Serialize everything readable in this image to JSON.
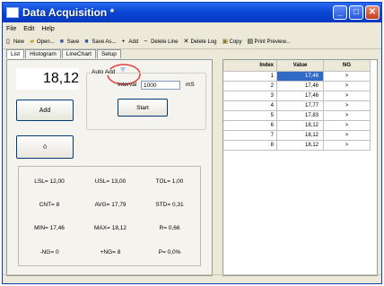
{
  "window": {
    "title": "Data Acquisition *"
  },
  "menu": [
    "File",
    "Edit",
    "Help"
  ],
  "toolbar": {
    "new": "New",
    "open": "Open...",
    "save": "Save",
    "save_as": "Save As...",
    "add": "Add",
    "delete_line": "Delete Line",
    "delete_log": "Delete Log",
    "copy": "Copy",
    "print_preview": "Print Preview..."
  },
  "tabs": [
    "List",
    "Histogram",
    "LineChart",
    "Setup"
  ],
  "current_value": "18,12",
  "auto_add": {
    "legend": "Auto Add",
    "interval_label": "Interval",
    "interval_value": "1000",
    "unit": "mS",
    "start_label": "Start"
  },
  "add_button": "Add",
  "counter_value": "0",
  "stats": [
    [
      "LSL= 12,00",
      "USL= 13,00",
      "TOL= 1,00"
    ],
    [
      "CNT= 8",
      "AVG= 17,79",
      "STD= 0,31"
    ],
    [
      "MIN= 17,46",
      "MAX= 18,12",
      "R= 0,66"
    ],
    [
      "-NG= 0",
      "+NG= 8",
      "P= 0,0%"
    ]
  ],
  "grid": {
    "headers": [
      "Index",
      "Value",
      "NG"
    ],
    "rows": [
      [
        "1",
        "17,46",
        ">"
      ],
      [
        "2",
        "17,46",
        ">"
      ],
      [
        "3",
        "17,46",
        ">"
      ],
      [
        "4",
        "17,77",
        ">"
      ],
      [
        "5",
        "17,83",
        ">"
      ],
      [
        "6",
        "18,12",
        ">"
      ],
      [
        "7",
        "18,12",
        ">"
      ],
      [
        "8",
        "18,12",
        ">"
      ]
    ]
  },
  "colors": {
    "selection": "#316ac5",
    "annotation_circle": "#e0403a",
    "title_bar": "#0a48d6"
  }
}
